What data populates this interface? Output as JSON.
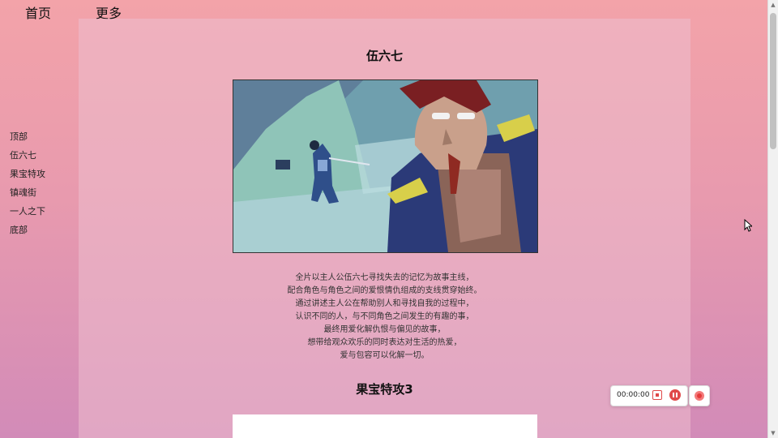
{
  "topnav": {
    "items": [
      {
        "label": "首页"
      },
      {
        "label": "更多"
      }
    ]
  },
  "sidebar": {
    "items": [
      {
        "label": "顶部"
      },
      {
        "label": "伍六七"
      },
      {
        "label": "果宝特攻"
      },
      {
        "label": "镇魂街"
      },
      {
        "label": "一人之下"
      },
      {
        "label": "底部"
      }
    ]
  },
  "main": {
    "sections": [
      {
        "title": "伍六七",
        "description": [
          "全片以主人公伍六七寻找失去的记忆为故事主线，",
          "配合角色与角色之间的爱恨情仇组成的支线贯穿始终。",
          "通过讲述主人公在帮助别人和寻找自我的过程中，",
          "认识不同的人，与不同角色之间发生的有趣的事，",
          "最终用爱化解仇恨与偏见的故事，",
          "想带给观众欢乐的同时表达对生活的热爱，",
          "爱与包容可以化解一切。"
        ]
      },
      {
        "title": "果宝特攻3"
      }
    ]
  },
  "recorder": {
    "time": "00:00:00",
    "stop_icon": "stop-icon",
    "pause_icon": "pause-icon",
    "record_icon": "record-icon"
  },
  "colors": {
    "bg_top": "#f3a3a9",
    "bg_bottom": "#d28bb8",
    "record_red": "#e04848"
  }
}
